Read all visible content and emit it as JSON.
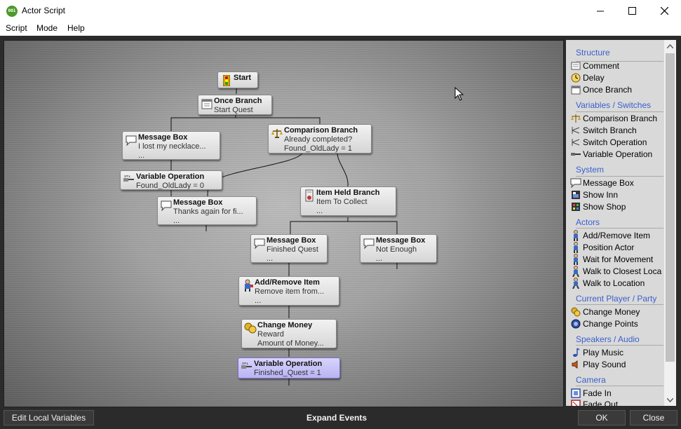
{
  "window": {
    "app_badge": "001",
    "title": "Actor Script"
  },
  "menu": [
    "Script",
    "Mode",
    "Help"
  ],
  "nodes": {
    "start": {
      "title": "Start"
    },
    "once_branch": {
      "title": "Once Branch",
      "line1": "Start Quest"
    },
    "msg_necklace": {
      "title": "Message Box",
      "line1": "I lost my necklace...",
      "line2": "..."
    },
    "comparison": {
      "title": "Comparison Branch",
      "line1": "Already completed?",
      "line2": "Found_OldLady = 1"
    },
    "var_op_1": {
      "title": "Variable Operation",
      "line1": "Found_OldLady = 0"
    },
    "msg_thanks": {
      "title": "Message Box",
      "line1": "Thanks again for fi...",
      "line2": "..."
    },
    "item_held": {
      "title": "Item Held Branch",
      "line1": "Item To Collect",
      "line2": "..."
    },
    "msg_finished": {
      "title": "Message Box",
      "line1": "Finished Quest",
      "line2": "..."
    },
    "msg_not_enough": {
      "title": "Message Box",
      "line1": "Not Enough",
      "line2": "..."
    },
    "add_remove": {
      "title": "Add/Remove Item",
      "line1": "Remove item from...",
      "line2": "..."
    },
    "change_money": {
      "title": "Change Money",
      "line1": "Reward",
      "line2": "Amount of Money..."
    },
    "var_op_2": {
      "title": "Variable Operation",
      "line1": "Finished_Quest = 1"
    }
  },
  "palette": {
    "categories": {
      "structure": "Structure",
      "variables": "Variables / Switches",
      "system": "System",
      "actors": "Actors",
      "party": "Current Player / Party",
      "audio": "Speakers / Audio",
      "camera": "Camera"
    },
    "items": {
      "comment": "Comment",
      "delay": "Delay",
      "once_branch": "Once Branch",
      "comparison_branch": "Comparison Branch",
      "switch_branch": "Switch Branch",
      "switch_operation": "Switch Operation",
      "variable_operation": "Variable Operation",
      "message_box": "Message Box",
      "show_inn": "Show Inn",
      "show_shop": "Show Shop",
      "add_remove_item": "Add/Remove Item",
      "position_actor": "Position Actor",
      "wait_for_movement": "Wait for Movement",
      "walk_to_closest": "Walk to Closest Loca",
      "walk_to_location": "Walk to Location",
      "change_money": "Change Money",
      "change_points": "Change Points",
      "play_music": "Play Music",
      "play_sound": "Play Sound",
      "fade_in": "Fade In",
      "fade_out": "Fade Out"
    }
  },
  "footer": {
    "edit_local_variables": "Edit Local Variables",
    "expand_events": "Expand Events",
    "ok": "OK",
    "close": "Close"
  },
  "colors": {
    "category_text": "#3a5fcd",
    "highlight_node": "#c4bff7",
    "frame": "#2b2b2b"
  }
}
